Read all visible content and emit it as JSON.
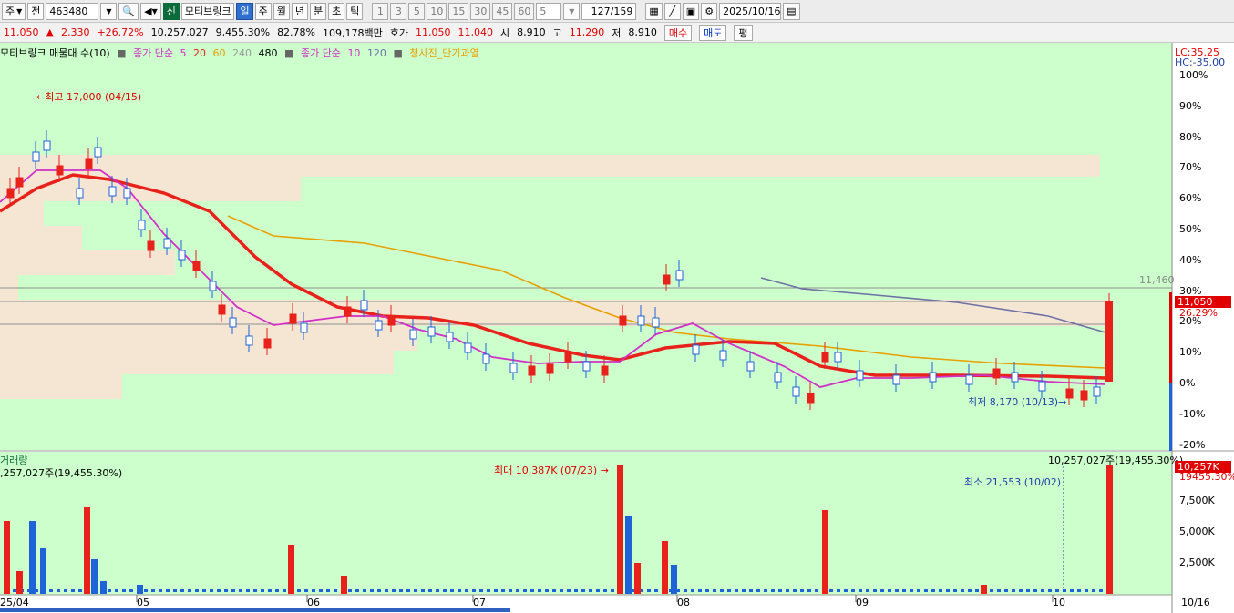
{
  "toolbar": {
    "market_label": "주",
    "prev_label": "전",
    "code_value": "463480",
    "tag_new": "신",
    "stock_name": "모티브링크",
    "period_day": "일",
    "period_week": "주",
    "period_month": "월",
    "period_year": "년",
    "period_min": "분",
    "period_sec": "초",
    "period_tick": "틱",
    "tick_presets": [
      "1",
      "3",
      "5",
      "10",
      "15",
      "30",
      "45",
      "60"
    ],
    "count_value": "5",
    "page_counter": "127/159",
    "date_value": "2025/10/16"
  },
  "quote": {
    "price": "11,050",
    "change": "2,330",
    "change_pct": "+26.72%",
    "volume": "10,257,027",
    "volume_ratio": "9,455.30%",
    "turnover": "82.78%",
    "amount": "109,178백만",
    "hoga_label": "호가",
    "ask": "11,050",
    "bid": "11,040",
    "open_label": "시",
    "open": "8,910",
    "high_label": "고",
    "high": "11,290",
    "low_label": "저",
    "low": "8,910",
    "buy_label": "매수",
    "sell_label": "매도",
    "eval_label": "평"
  },
  "legend": {
    "volume_profile": "모티브링크 매물대 수(10)",
    "sma_label": "종가 단순",
    "sma_periods": [
      "5",
      "20",
      "60",
      "240",
      "480"
    ],
    "sma2_label": "종가 단순",
    "sma2_periods": [
      "10",
      "120"
    ],
    "signal_label": "청사진_단기과열"
  },
  "annotations": {
    "high_note": "최고 17,000 (04/15)",
    "low_note": "최저 8,170 (10/13)",
    "vol_max_note": "최대 10,387K (07/23)",
    "vol_min_note": "최소 21,553 (10/02)",
    "ref_price": "11,460",
    "lc": "LC:35.25",
    "hc": "HC:-35.00",
    "last_price_badge": "11,050",
    "last_pct_badge": "26.29%",
    "vol_header_right": "10,257,027주(19,455.30%)",
    "vol_badge": "10,257K",
    "vol_badge_pct": "19455.30%"
  },
  "volume_panel": {
    "title": "거래량",
    "subtitle": ",257,027주(19,455.30%)"
  },
  "price_axis": [
    "100%",
    "90%",
    "80%",
    "70%",
    "60%",
    "50%",
    "40%",
    "30%",
    "20%",
    "10%",
    "0%",
    "-10%",
    "-20%"
  ],
  "volume_axis": [
    "7,500K",
    "5,000K",
    "2,500K"
  ],
  "date_axis": [
    "25/04",
    "05",
    "06",
    "07",
    "08",
    "09",
    "10",
    "10/16"
  ],
  "colors": {
    "chart_bg": "#ccffcc",
    "up": "#e8221b",
    "down": "#1e63d8",
    "ma5": "#d030c8",
    "ma20": "#e8221b",
    "ma60": "#e8a000",
    "ma120": "#7070a8"
  }
}
